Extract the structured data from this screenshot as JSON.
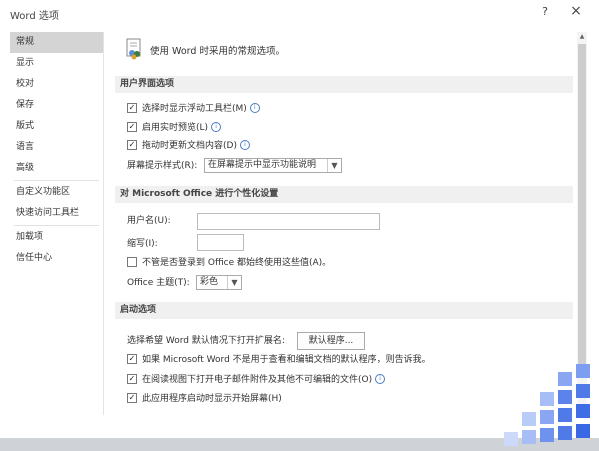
{
  "window": {
    "title": "Word 选项",
    "help_label": "?",
    "close_label": "×"
  },
  "sidebar": {
    "items": [
      {
        "label": "常规"
      },
      {
        "label": "显示"
      },
      {
        "label": "校对"
      },
      {
        "label": "保存"
      },
      {
        "label": "版式"
      },
      {
        "label": "语言"
      },
      {
        "label": "高级"
      },
      {
        "label": "自定义功能区"
      },
      {
        "label": "快速访问工具栏"
      },
      {
        "label": "加载项"
      },
      {
        "label": "信任中心"
      }
    ]
  },
  "header": {
    "text": "使用 Word 时采用的常规选项。"
  },
  "ui_section": {
    "title": "用户界面选项",
    "options": [
      {
        "label": "选择时显示浮动工具栏(M)",
        "checked": true
      },
      {
        "label": "启用实时预览(L)",
        "checked": true
      },
      {
        "label": "拖动时更新文档内容(D)",
        "checked": true
      }
    ],
    "tooltip_label": "屏幕提示样式(R):",
    "tooltip_value": "在屏幕提示中显示功能说明"
  },
  "personalize_section": {
    "title": "对 Microsoft Office 进行个性化设置",
    "username_label": "用户名(U):",
    "username_value": "",
    "initials_label": "缩写(I):",
    "initials_value": "",
    "always_use_label": "不管是否登录到 Office 都始终使用这些值(A)。",
    "always_use_checked": false,
    "theme_label": "Office 主题(T):",
    "theme_value": "彩色"
  },
  "startup_section": {
    "title": "启动选项",
    "default_ext_label": "选择希望 Word 默认情况下打开扩展名:",
    "default_programs_button": "默认程序...",
    "options": [
      {
        "label": "如果 Microsoft Word 不是用于查看和编辑文档的默认程序，则告诉我。",
        "checked": true
      },
      {
        "label": "在阅读视图下打开电子邮件附件及其他不可编辑的文件(O)",
        "checked": true
      },
      {
        "label": "此应用程序启动时显示开始屏幕(H)",
        "checked": true
      }
    ]
  },
  "colors": {
    "selected_sidebar": "#d4d4d4",
    "section_bg": "#f0f0f0",
    "info_icon": "#4a7ec2"
  }
}
